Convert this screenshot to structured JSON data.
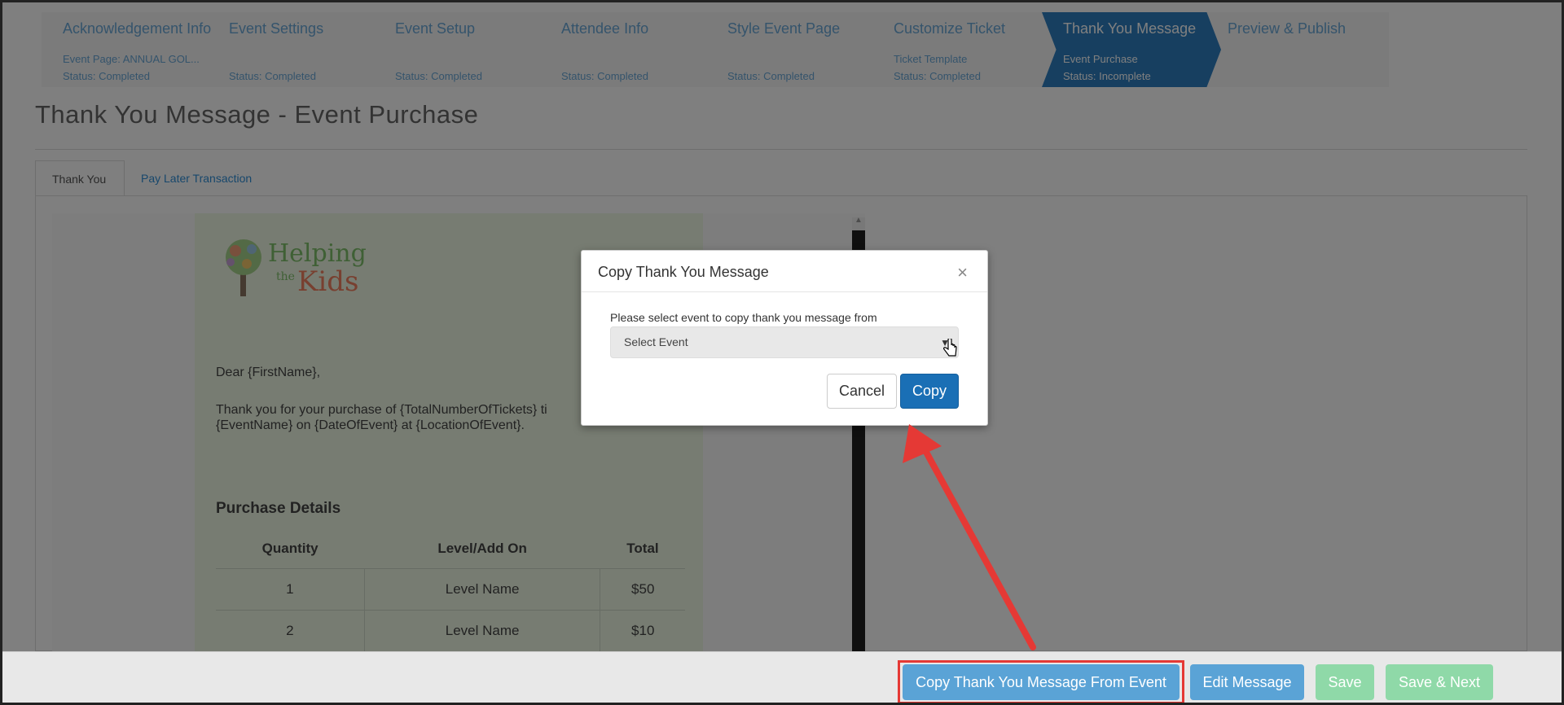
{
  "wizard": {
    "steps": [
      {
        "title": "Acknowledgement Info",
        "sub": "Event Page: ANNUAL GOL...",
        "status": "Status: Completed"
      },
      {
        "title": "Event Settings",
        "sub": "",
        "status": "Status: Completed"
      },
      {
        "title": "Event Setup",
        "sub": "",
        "status": "Status: Completed"
      },
      {
        "title": "Attendee Info",
        "sub": "",
        "status": "Status: Completed"
      },
      {
        "title": "Style Event Page",
        "sub": "",
        "status": "Status: Completed"
      },
      {
        "title": "Customize Ticket",
        "sub": "Ticket Template",
        "status": "Status: Completed"
      },
      {
        "title": "Thank You Message",
        "sub": "Event Purchase",
        "status": "Status: Incomplete"
      },
      {
        "title": "Preview & Publish",
        "sub": "",
        "status": ""
      }
    ],
    "active_index": 6
  },
  "page": {
    "title": "Thank You Message - Event Purchase"
  },
  "tabs": [
    "Thank You",
    "Pay Later Transaction"
  ],
  "email": {
    "logo": {
      "line1": "Helping",
      "line2": "the",
      "line3": "Kids"
    },
    "greeting": "Dear {FirstName},",
    "body_line1": "Thank you for your purchase of {TotalNumberOfTickets} ti",
    "body_line2": "{EventName} on {DateOfEvent} at {LocationOfEvent}.",
    "purchase_title": "Purchase Details",
    "table": {
      "headers": [
        "Quantity",
        "Level/Add On",
        "Total"
      ],
      "rows": [
        [
          "1",
          "Level Name",
          "$50"
        ],
        [
          "2",
          "Level Name",
          "$10"
        ]
      ]
    }
  },
  "modal": {
    "title": "Copy Thank You Message",
    "close": "×",
    "label": "Please select event to copy thank you message from",
    "select_value": "Select Event",
    "cancel": "Cancel",
    "copy": "Copy"
  },
  "bottom": {
    "copy_from_event": "Copy Thank You Message From Event",
    "edit_message": "Edit Message",
    "save": "Save",
    "save_next": "Save & Next"
  },
  "colors": {
    "accent": "#2f7fc1",
    "annotation": "#e53935",
    "save": "#8fd9a8"
  },
  "icons": {
    "close": "close-icon",
    "caret": "caret-down-icon",
    "cursor": "hand-pointer-icon"
  }
}
